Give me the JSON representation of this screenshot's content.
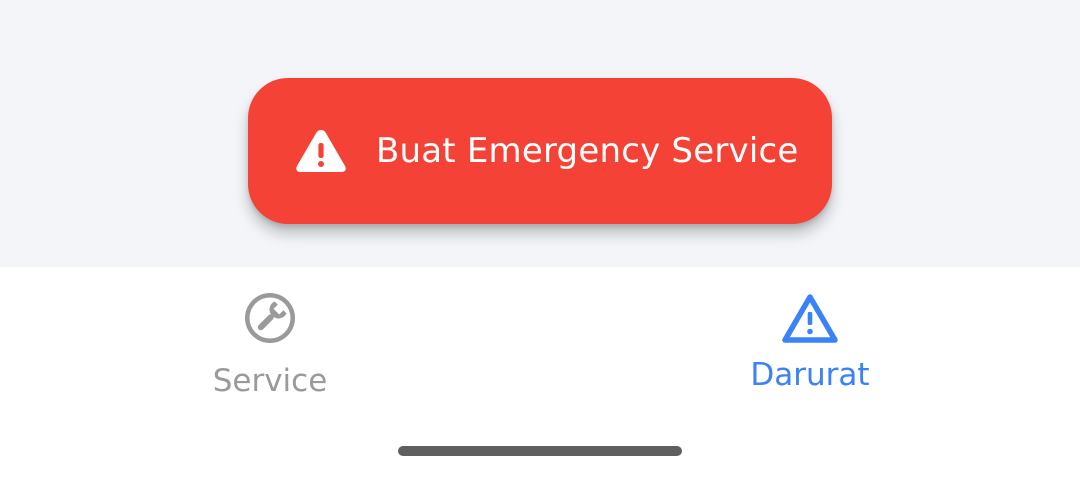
{
  "emergency_button": {
    "label": "Buat Emergency Service",
    "icon": "warning-triangle-icon",
    "background": "#f44236",
    "text_color": "#ffffff"
  },
  "bottom_nav": {
    "items": [
      {
        "label": "Service",
        "icon": "wrench-icon",
        "active": false,
        "color": "#9a9a9a"
      },
      {
        "label": "Darurat",
        "icon": "warning-triangle-icon",
        "active": true,
        "color": "#3b82f6"
      }
    ]
  },
  "colors": {
    "content_background": "#f4f5f9",
    "nav_background": "#ffffff",
    "home_indicator": "#5f5f5f"
  }
}
